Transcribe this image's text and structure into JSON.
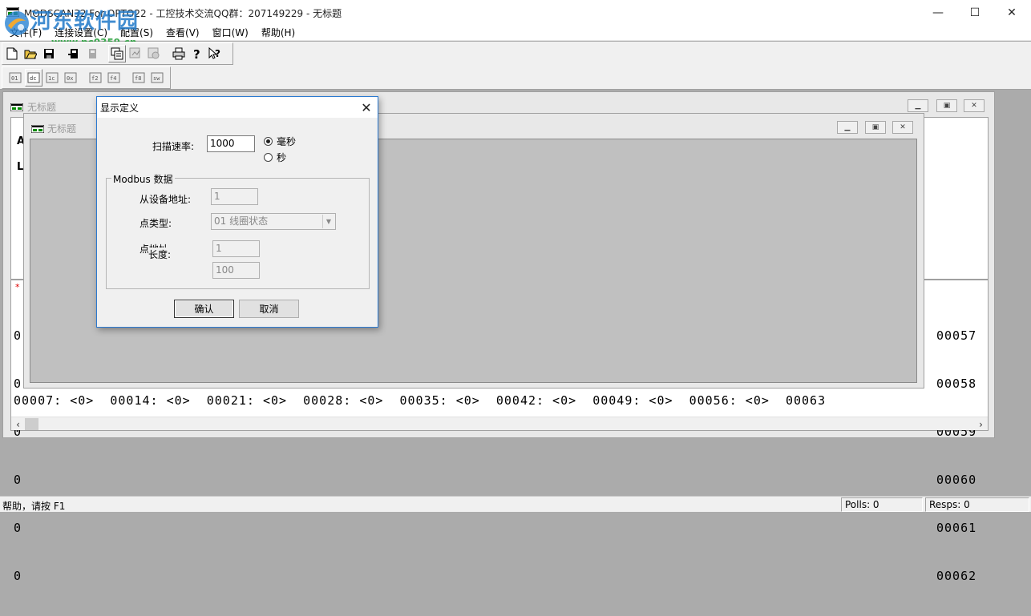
{
  "window": {
    "title": "MODSCAN32 For OPTO22 - 工控技术交流QQ群：207149229 - 无标题",
    "watermark_name": "河东软件园",
    "watermark_url": "www.pc0359.cn",
    "controls": {
      "minimize": "—",
      "maximize": "☐",
      "close": "✕"
    }
  },
  "menu": [
    "文件(F)",
    "连接设置(C)",
    "配置(S)",
    "查看(V)",
    "窗口(W)",
    "帮助(H)"
  ],
  "toolbar": {
    "row1_icons": [
      "new-icon",
      "open-icon",
      "save-icon",
      "connect-icon",
      "disconnect-icon",
      "display-icon",
      "scan-icon",
      "record-icon",
      "print-icon",
      "help-icon",
      "context-help-icon"
    ],
    "row2_icons": [
      "format-01-icon",
      "format-02-icon",
      "format-03-icon",
      "format-04-icon",
      "format-05-icon",
      "format-06-icon",
      "format-07-icon",
      "format-08-icon"
    ]
  },
  "child_back": {
    "title": "无标题",
    "label_a": "A",
    "label_l": "L",
    "left_values": [
      "0",
      "0",
      "0",
      "0",
      "0",
      "0"
    ],
    "right_values": [
      "00057",
      "00058",
      "00059",
      "00060",
      "00061",
      "00062"
    ],
    "bottom_row": "00007: <0>  00014: <0>  00021: <0>  00028: <0>  00035: <0>  00042: <0>  00049: <0>  00056: <0>  00063"
  },
  "child_front": {
    "title": "无标题"
  },
  "dialog": {
    "title": "显示定义",
    "scan_rate_label": "扫描速率:",
    "scan_rate_value": "1000",
    "unit_ms": "毫秒",
    "unit_s": "秒",
    "group_title": "Modbus 数据",
    "slave_addr_label": "从设备地址:",
    "slave_addr_value": "1",
    "point_type_label": "点类型:",
    "point_type_value": "01 线圈状态",
    "point_label_a": "点地址",
    "point_label_b": "长度:",
    "address_value": "1",
    "length_value": "100",
    "ok": "确认",
    "cancel": "取消"
  },
  "status": {
    "help": "帮助，请按 F1",
    "polls": "Polls: 0",
    "resps": "Resps: 0"
  }
}
